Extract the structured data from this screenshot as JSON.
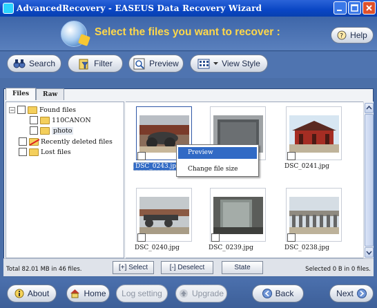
{
  "window": {
    "title": "AdvancedRecovery - EASEUS Data Recovery Wizard",
    "controls": [
      "minimize-icon",
      "maximize-icon",
      "close-icon"
    ]
  },
  "header": {
    "heading": "Select the files you want to recover :",
    "help_label": "Help",
    "accent_color": "#ffd84a"
  },
  "toolbar": {
    "search_label": "Search",
    "filter_label": "Filter",
    "preview_label": "Preview",
    "view_style_label": "View Style"
  },
  "tabs": [
    {
      "label": "Files",
      "active": true
    },
    {
      "label": "Raw",
      "active": false
    }
  ],
  "tree": {
    "items": [
      {
        "label": "Found files",
        "expander": "−",
        "icon": "folder-icon"
      },
      {
        "label": "110CANON",
        "icon": "folder-icon"
      },
      {
        "label": "photo",
        "icon": "folder-icon"
      },
      {
        "label": "Recently deleted files",
        "icon": "deleted-folder-icon"
      },
      {
        "label": "Lost files",
        "icon": "folder-icon"
      }
    ]
  },
  "gallery": {
    "files": [
      {
        "name": "DSC_0243.jpg",
        "selected": true
      },
      {
        "name": ""
      },
      {
        "name": "DSC_0241.jpg"
      },
      {
        "name": "DSC_0240.jpg"
      },
      {
        "name": "DSC_0239.jpg"
      },
      {
        "name": "DSC_0238.jpg"
      }
    ]
  },
  "context_menu": {
    "items": [
      {
        "label": "Preview",
        "highlighted": true
      },
      {
        "label": "Change file size",
        "highlighted": false
      }
    ]
  },
  "status": {
    "total": "Total 82.01 MB in 46 files.",
    "selected": "Selected 0 B in 0 files.",
    "select_label": "[+] Select",
    "deselect_label": "[-] Deselect",
    "state_label": "State"
  },
  "footer": {
    "about_label": "About",
    "home_label": "Home",
    "log_label": "Log setting",
    "upgrade_label": "Upgrade",
    "back_label": "Back",
    "next_label": "Next"
  }
}
